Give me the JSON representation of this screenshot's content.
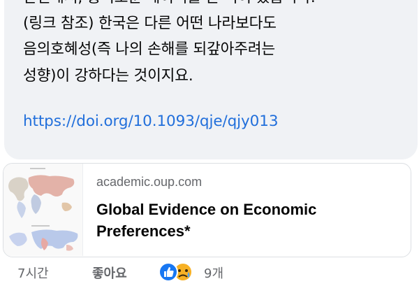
{
  "message": {
    "lines": [
      "관련해서, 흥미로운 데이터를 본 적이 있습니다.",
      "(링크 참조) 한국은 다른 어떤 나라보다도",
      "음의호혜성(즉 나의 손해를 되갚아주려는",
      "성향)이 강하다는 것이지요."
    ],
    "link": "https://doi.org/10.1093/qje/qjy013"
  },
  "preview": {
    "domain": "academic.oup.com",
    "title": "Global Evidence on Economic Preferences*"
  },
  "footer": {
    "time": "7시간",
    "like_label": "좋아요",
    "reaction_count": "9개",
    "reactions": [
      "like-icon",
      "sad-icon"
    ]
  },
  "colors": {
    "bubble": "#f0f2f5",
    "link": "#216fdb",
    "like_blue": "#1877f2",
    "sad_yellow": "#f7b125"
  }
}
